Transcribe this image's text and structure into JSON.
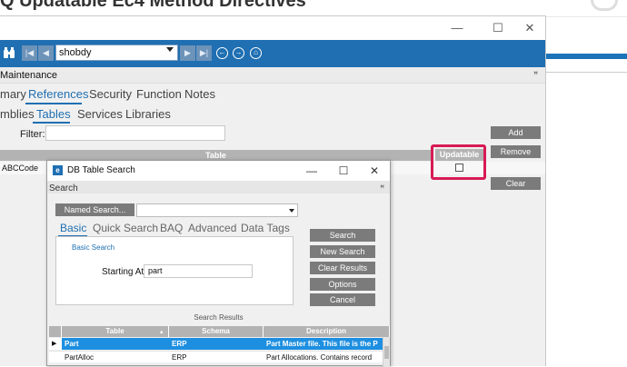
{
  "background_page": {
    "title": "Q Updatable Ec4 Method Directives"
  },
  "window": {
    "controls": {
      "minimize": "—",
      "maximize": "☐",
      "close": "✕"
    },
    "toolbar": {
      "company_value": "shobdy"
    },
    "maintenance_label": "Maintenance",
    "pin_symbol": "ꟸ",
    "tabs_row1": [
      "mary",
      "References",
      "Security",
      "Function",
      "Notes"
    ],
    "tabs_row1_active": "References",
    "tabs_row2": [
      "mblies",
      "Tables",
      "Services",
      "Libraries"
    ],
    "tabs_row2_active": "Tables",
    "filter_label": "Filter:",
    "grid": {
      "column_header": "Table",
      "updatable_header": "Updatable",
      "row_value": "ABCCode"
    },
    "side_buttons": [
      "Add",
      "Remove",
      "Clear"
    ]
  },
  "dialog": {
    "title": "DB Table Search",
    "search_label": "Search",
    "named_search_button": "Named Search...",
    "tabs": [
      "Basic",
      "Quick Search",
      "BAQ",
      "Advanced",
      "Data Tags"
    ],
    "active_tab": "Basic",
    "basic_search_label": "Basic Search",
    "starting_at_label": "Starting At:",
    "starting_at_value": "part",
    "buttons": [
      "Search",
      "New Search",
      "Clear Results",
      "Options",
      "Cancel"
    ],
    "results_label": "Search Results",
    "results_columns": [
      "Table",
      "Schema",
      "Description"
    ],
    "results_rows": [
      {
        "table": "Part",
        "schema": "ERP",
        "description": "Part Master file. This file is the P",
        "selected": true
      },
      {
        "table": "PartAlloc",
        "schema": "ERP",
        "description": "Part Allocations. Contains record",
        "selected": false
      }
    ]
  },
  "colors": {
    "accent_blue": "#1f6fb2",
    "highlight_red": "#d81b55",
    "selected_row": "#1e8fe0"
  }
}
